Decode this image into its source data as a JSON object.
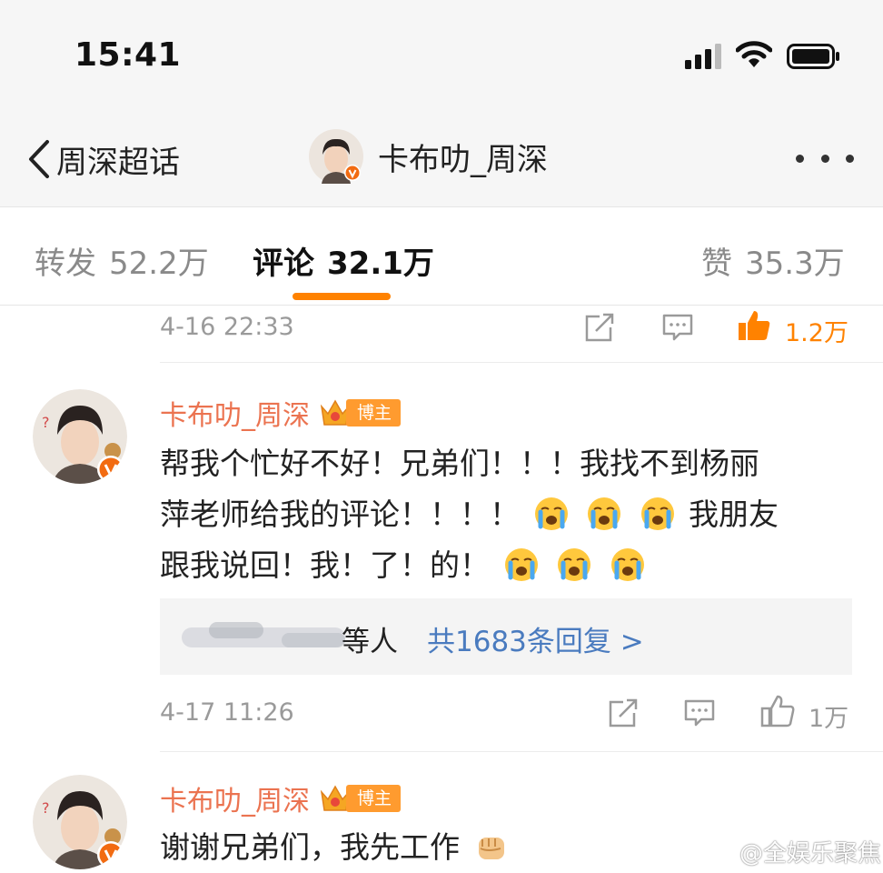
{
  "status_bar": {
    "time": "15:41"
  },
  "nav": {
    "back_label": "周深超话",
    "title": "卡布叻_周深"
  },
  "tabs": {
    "repost_label": "转发",
    "repost_count": "52.2万",
    "comment_label": "评论",
    "comment_count": "32.1万",
    "like_label": "赞",
    "like_count": "35.3万"
  },
  "top_meta": {
    "date": "4-16 22:33",
    "likes": "1.2万"
  },
  "comments": [
    {
      "author": "卡布叻_周深",
      "badge": "博主",
      "line1": "帮我个忙好不好！兄弟们！！！我找不到杨丽",
      "line2a": "萍老师给我的评论！！！！",
      "line2b": "我朋友",
      "line3": "跟我说回！我！了！的！",
      "reply_suffix": "等人",
      "reply_link": "共1683条回复 >",
      "date": "4-17 11:26",
      "likes": "1万"
    },
    {
      "author": "卡布叻_周深",
      "badge": "博主",
      "text": "谢谢兄弟们，我先工作"
    }
  ],
  "watermark": "@全娱乐聚焦",
  "colors": {
    "accent": "#ff8200",
    "author": "#eb7350",
    "link": "#4a7bbf",
    "badge": "#ff9b2f"
  },
  "icons": [
    "back-chevron-icon",
    "signal-icon",
    "wifi-icon",
    "battery-icon",
    "more-icon",
    "repost-icon",
    "comment-icon",
    "like-icon",
    "crown-icon",
    "crying-emoji-icon",
    "fist-emoji-icon",
    "weibo-logo-icon"
  ]
}
